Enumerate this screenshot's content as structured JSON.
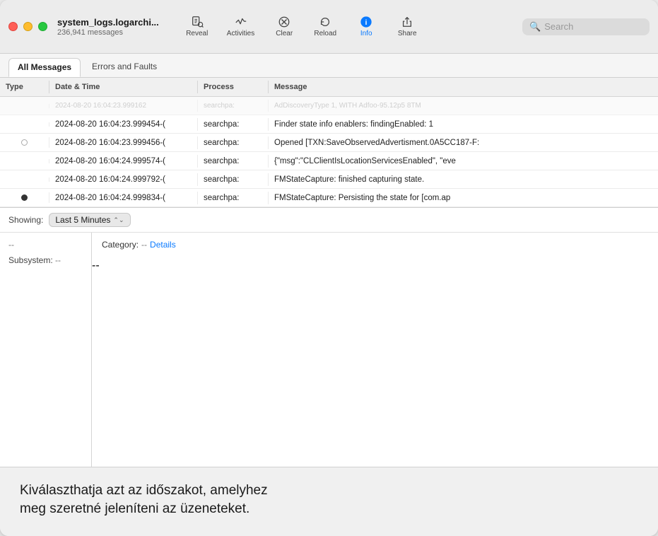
{
  "window": {
    "title": "system_logs.logarchi...",
    "subtitle": "236,941 messages"
  },
  "toolbar": {
    "reveal_label": "Reveal",
    "activities_label": "Activities",
    "clear_label": "Clear",
    "reload_label": "Reload",
    "info_label": "Info",
    "share_label": "Share",
    "search_placeholder": "Search"
  },
  "tabs": [
    {
      "label": "All Messages",
      "active": true
    },
    {
      "label": "Errors and Faults",
      "active": false
    }
  ],
  "table": {
    "columns": [
      "Type",
      "Date & Time",
      "Process",
      "Message"
    ],
    "rows": [
      {
        "type": "",
        "datetime": "2024-08-20 16:04:23.999162",
        "process": "searchpa:",
        "message": "AdDiscoveryType 1, WITH Adfoo-95.12p5 8TM",
        "dot": "none"
      },
      {
        "type": "",
        "datetime": "2024-08-20 16:04:23.999454-(",
        "process": "searchpa:",
        "message": "Finder state info enablers:   findingEnabled: 1",
        "dot": "none"
      },
      {
        "type": "empty-dot",
        "datetime": "2024-08-20 16:04:23.999456-(",
        "process": "searchpa:",
        "message": "Opened [TXN:SaveObservedAdvertisment.0A5CC187-F:",
        "dot": "empty"
      },
      {
        "type": "",
        "datetime": "2024-08-20 16:04:24.999574-(",
        "process": "searchpa:",
        "message": "{\"msg\":\"CLClientIsLocationServicesEnabled\", \"eve",
        "dot": "none"
      },
      {
        "type": "",
        "datetime": "2024-08-20 16:04:24.999792-(",
        "process": "searchpa:",
        "message": "FMStateCapture: finished capturing state.",
        "dot": "none"
      },
      {
        "type": "filled-dot",
        "datetime": "2024-08-20 16:04:24.999834-(",
        "process": "searchpa:",
        "message": "FMStateCapture: Persisting the state for [com.ap",
        "dot": "filled"
      }
    ]
  },
  "detail": {
    "showing_label": "Showing:",
    "showing_value": "Last 5 Minutes",
    "dash": "--",
    "subsystem_label": "Subsystem:",
    "subsystem_value": "--",
    "category_label": "Category:",
    "category_value": "--",
    "details_link": "Details",
    "right_value": "--"
  },
  "annotation": {
    "text": "Kiválaszthatja azt az időszakot, amelyhez\nmeg szeretné jeleníteni az üzeneteket."
  }
}
